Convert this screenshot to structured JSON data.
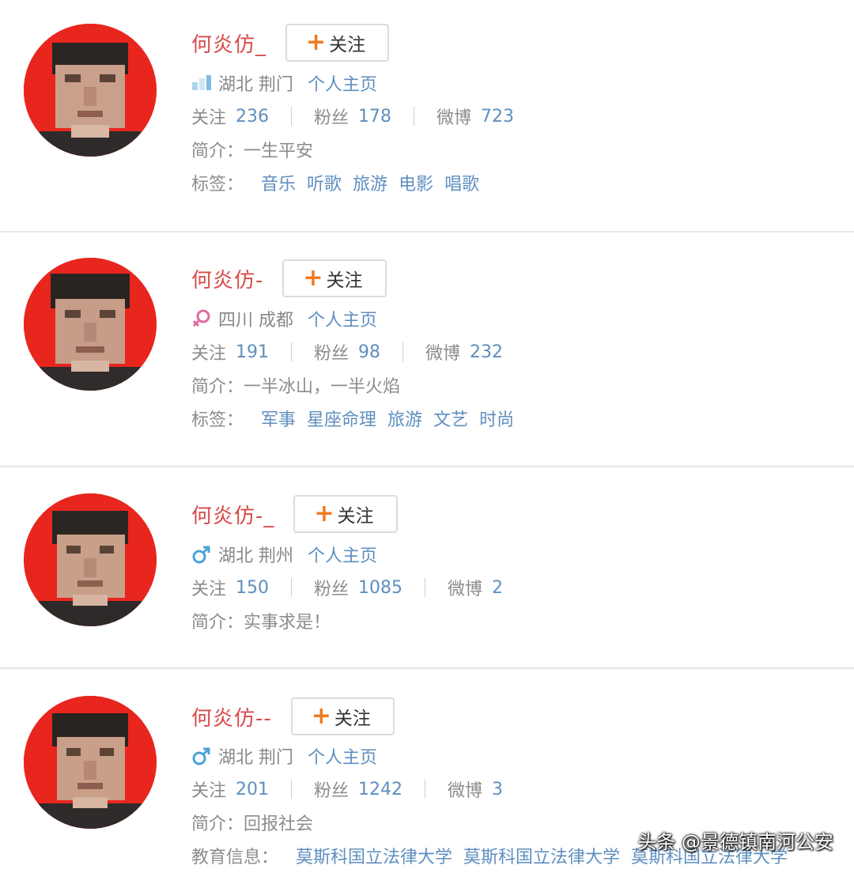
{
  "profiles": [
    {
      "name": "何炎仿_",
      "follow_label": "关注",
      "gender_icon": "unknown-icon",
      "location": "湖北 荆门",
      "homepage_label": "个人主页",
      "following_label": "关注",
      "following": "236",
      "fans_label": "粉丝",
      "fans": "178",
      "weibo_label": "微博",
      "weibo": "723",
      "bio_label": "简介：",
      "bio": "一生平安",
      "tags_label": "标签：",
      "tags": [
        "音乐",
        "听歌",
        "旅游",
        "电影",
        "唱歌"
      ]
    },
    {
      "name": "何炎仿-",
      "follow_label": "关注",
      "gender_icon": "female-icon",
      "location": "四川 成都",
      "homepage_label": "个人主页",
      "following_label": "关注",
      "following": "191",
      "fans_label": "粉丝",
      "fans": "98",
      "weibo_label": "微博",
      "weibo": "232",
      "bio_label": "简介：",
      "bio": "一半冰山，一半火焰",
      "tags_label": "标签：",
      "tags": [
        "军事",
        "星座命理",
        "旅游",
        "文艺",
        "时尚"
      ]
    },
    {
      "name": "何炎仿-_",
      "follow_label": "关注",
      "gender_icon": "male-icon",
      "location": "湖北 荆州",
      "homepage_label": "个人主页",
      "following_label": "关注",
      "following": "150",
      "fans_label": "粉丝",
      "fans": "1085",
      "weibo_label": "微博",
      "weibo": "2",
      "bio_label": "简介：",
      "bio": "实事求是！"
    },
    {
      "name": "何炎仿--",
      "follow_label": "关注",
      "gender_icon": "male-icon",
      "location": "湖北 荆门",
      "homepage_label": "个人主页",
      "following_label": "关注",
      "following": "201",
      "fans_label": "粉丝",
      "fans": "1242",
      "weibo_label": "微博",
      "weibo": "3",
      "bio_label": "简介：",
      "bio": "回报社会",
      "edu_label": "教育信息：",
      "edu": [
        "莫斯科国立法律大学",
        "莫斯科国立法律大学",
        "莫斯科国立法律大学"
      ]
    }
  ],
  "watermark": "头条 @景德镇南河公安",
  "colors": {
    "name": "#d94a4a",
    "link": "#5f8fbf",
    "plus": "#f07b21",
    "avatar_bg": "#e8261e",
    "female": "#e06aa0",
    "male": "#4aa3d8"
  }
}
